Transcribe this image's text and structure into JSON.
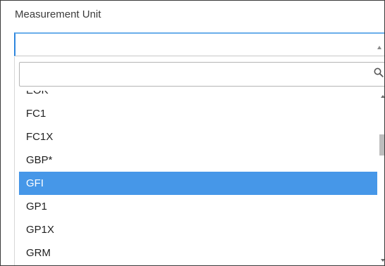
{
  "field": {
    "label": "Measurement Unit",
    "selected_value": ""
  },
  "search": {
    "value": "",
    "placeholder": "",
    "icon": "search-icon"
  },
  "options": [
    {
      "label": "EOK",
      "selected": false
    },
    {
      "label": "FC1",
      "selected": false
    },
    {
      "label": "FC1X",
      "selected": false
    },
    {
      "label": "GBP*",
      "selected": false
    },
    {
      "label": "GFI",
      "selected": true
    },
    {
      "label": "GP1",
      "selected": false
    },
    {
      "label": "GP1X",
      "selected": false
    },
    {
      "label": "GRM",
      "selected": false
    }
  ],
  "colors": {
    "highlight": "#4697e8",
    "focus_border": "#2e86de"
  }
}
